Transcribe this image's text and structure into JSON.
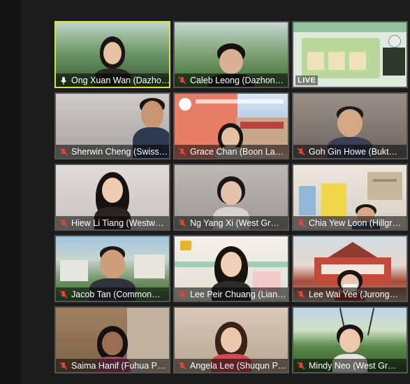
{
  "participants": [
    {
      "name": "Ong Xuan Wan (Dazho…",
      "active_speaker": true,
      "mic_muted": false
    },
    {
      "name": "Caleb Leong (Dazhon…",
      "active_speaker": false,
      "mic_muted": true
    },
    {
      "name": "",
      "live_badge": "LIVE",
      "active_speaker": false,
      "mic_muted": false
    },
    {
      "name": "Sherwin Cheng (Swiss…",
      "active_speaker": false,
      "mic_muted": true
    },
    {
      "name": "Grace Chan (Boon La…",
      "active_speaker": false,
      "mic_muted": true
    },
    {
      "name": "Goh Gin Howe (Bukt…",
      "active_speaker": false,
      "mic_muted": true
    },
    {
      "name": "Hiew Li Tiang (Westw…",
      "active_speaker": false,
      "mic_muted": true
    },
    {
      "name": "Ng Yang Xi (West Gr…",
      "active_speaker": false,
      "mic_muted": true
    },
    {
      "name": "Chia Yew Loon (Hillgr…",
      "active_speaker": false,
      "mic_muted": true
    },
    {
      "name": "Jacob Tan (Common…",
      "active_speaker": false,
      "mic_muted": true
    },
    {
      "name": "Lee Peir Chuang (Lian…",
      "active_speaker": false,
      "mic_muted": true
    },
    {
      "name": "Lee Wai Yee (Jurong…",
      "active_speaker": false,
      "mic_muted": true
    },
    {
      "name": "Saima Hanif (Fuhua P…",
      "active_speaker": false,
      "mic_muted": true
    },
    {
      "name": "Angela Lee (Shuqun P…",
      "active_speaker": false,
      "mic_muted": true
    },
    {
      "name": "Mindy Neo (West Gr…",
      "active_speaker": false,
      "mic_muted": true
    }
  ],
  "colors": {
    "active_border": "#d8e23a",
    "muted_mic": "#e0463a",
    "nameplate_text": "#ffffff"
  }
}
